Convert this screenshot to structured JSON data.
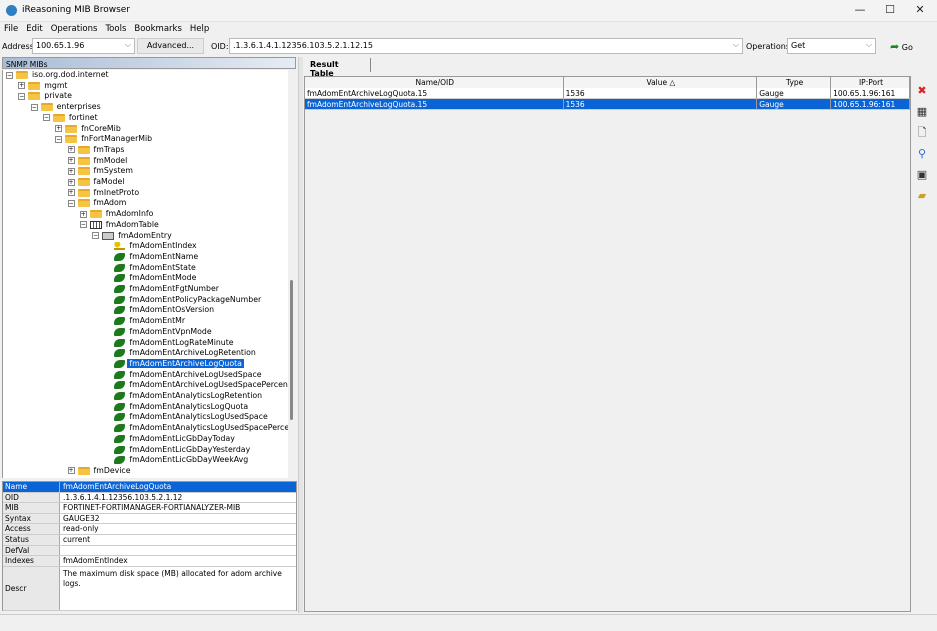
{
  "window": {
    "title": "iReasoning MIB Browser",
    "minimize": "—",
    "maximize": "☐",
    "close": "✕"
  },
  "menu": [
    "File",
    "Edit",
    "Operations",
    "Tools",
    "Bookmarks",
    "Help"
  ],
  "toolbar": {
    "address_label": "Address:",
    "address": "100.65.1.96",
    "advanced": "Advanced...",
    "oid_label": "OID:",
    "oid": ".1.3.6.1.4.1.12356.103.5.2.1.12.15",
    "operations_label": "Operations:",
    "operation": "Get",
    "go": "Go"
  },
  "tree": {
    "header": "SNMP MIBs",
    "nodes": [
      {
        "label": "iso.org.dod.internet",
        "lvl": 0,
        "icon": "folder",
        "exp": "-"
      },
      {
        "label": "mgmt",
        "lvl": 1,
        "icon": "folder",
        "exp": "+"
      },
      {
        "label": "private",
        "lvl": 1,
        "icon": "folder",
        "exp": "-"
      },
      {
        "label": "enterprises",
        "lvl": 2,
        "icon": "folder",
        "exp": "-"
      },
      {
        "label": "fortinet",
        "lvl": 3,
        "icon": "folder",
        "exp": "-"
      },
      {
        "label": "fnCoreMib",
        "lvl": 4,
        "icon": "folder",
        "exp": "+"
      },
      {
        "label": "fnFortManagerMib",
        "lvl": 4,
        "icon": "folder",
        "exp": "-"
      },
      {
        "label": "fmTraps",
        "lvl": 5,
        "icon": "folder",
        "exp": "+"
      },
      {
        "label": "fmModel",
        "lvl": 5,
        "icon": "folder",
        "exp": "+"
      },
      {
        "label": "fmSystem",
        "lvl": 5,
        "icon": "folder",
        "exp": "+"
      },
      {
        "label": "faModel",
        "lvl": 5,
        "icon": "folder",
        "exp": "+"
      },
      {
        "label": "fmInetProto",
        "lvl": 5,
        "icon": "folder",
        "exp": "+"
      },
      {
        "label": "fmAdom",
        "lvl": 5,
        "icon": "folder",
        "exp": "-"
      },
      {
        "label": "fmAdomInfo",
        "lvl": 6,
        "icon": "folder",
        "exp": "+"
      },
      {
        "label": "fmAdomTable",
        "lvl": 6,
        "icon": "table",
        "exp": "-"
      },
      {
        "label": "fmAdomEntry",
        "lvl": 7,
        "icon": "entry",
        "exp": "-"
      },
      {
        "label": "fmAdomEntIndex",
        "lvl": 8,
        "icon": "key",
        "exp": ""
      },
      {
        "label": "fmAdomEntName",
        "lvl": 8,
        "icon": "leaf",
        "exp": ""
      },
      {
        "label": "fmAdomEntState",
        "lvl": 8,
        "icon": "leaf",
        "exp": ""
      },
      {
        "label": "fmAdomEntMode",
        "lvl": 8,
        "icon": "leaf",
        "exp": ""
      },
      {
        "label": "fmAdomEntFgtNumber",
        "lvl": 8,
        "icon": "leaf",
        "exp": ""
      },
      {
        "label": "fmAdomEntPolicyPackageNumber",
        "lvl": 8,
        "icon": "leaf",
        "exp": ""
      },
      {
        "label": "fmAdomEntOsVersion",
        "lvl": 8,
        "icon": "leaf",
        "exp": ""
      },
      {
        "label": "fmAdomEntMr",
        "lvl": 8,
        "icon": "leaf",
        "exp": ""
      },
      {
        "label": "fmAdomEntVpnMode",
        "lvl": 8,
        "icon": "leaf",
        "exp": ""
      },
      {
        "label": "fmAdomEntLogRateMinute",
        "lvl": 8,
        "icon": "leaf",
        "exp": ""
      },
      {
        "label": "fmAdomEntArchiveLogRetention",
        "lvl": 8,
        "icon": "leaf",
        "exp": ""
      },
      {
        "label": "fmAdomEntArchiveLogQuota",
        "lvl": 8,
        "icon": "leaf",
        "exp": "",
        "selected": true
      },
      {
        "label": "fmAdomEntArchiveLogUsedSpace",
        "lvl": 8,
        "icon": "leaf",
        "exp": ""
      },
      {
        "label": "fmAdomEntArchiveLogUsedSpacePercent",
        "lvl": 8,
        "icon": "leaf",
        "exp": ""
      },
      {
        "label": "fmAdomEntAnalyticsLogRetention",
        "lvl": 8,
        "icon": "leaf",
        "exp": ""
      },
      {
        "label": "fmAdomEntAnalyticsLogQuota",
        "lvl": 8,
        "icon": "leaf",
        "exp": ""
      },
      {
        "label": "fmAdomEntAnalyticsLogUsedSpace",
        "lvl": 8,
        "icon": "leaf",
        "exp": ""
      },
      {
        "label": "fmAdomEntAnalyticsLogUsedSpacePercent",
        "lvl": 8,
        "icon": "leaf",
        "exp": ""
      },
      {
        "label": "fmAdomEntLicGbDayToday",
        "lvl": 8,
        "icon": "leaf",
        "exp": ""
      },
      {
        "label": "fmAdomEntLicGbDayYesterday",
        "lvl": 8,
        "icon": "leaf",
        "exp": ""
      },
      {
        "label": "fmAdomEntLicGbDayWeekAvg",
        "lvl": 8,
        "icon": "leaf",
        "exp": ""
      },
      {
        "label": "fmDevice",
        "lvl": 5,
        "icon": "folder",
        "exp": "+"
      }
    ]
  },
  "details": [
    {
      "k": "Name",
      "v": "fmAdomEntArchiveLogQuota"
    },
    {
      "k": "OID",
      "v": ".1.3.6.1.4.1.12356.103.5.2.1.12"
    },
    {
      "k": "MIB",
      "v": "FORTINET-FORTIMANAGER-FORTIANALYZER-MIB"
    },
    {
      "k": "Syntax",
      "v": "GAUGE32"
    },
    {
      "k": "Access",
      "v": "read-only"
    },
    {
      "k": "Status",
      "v": "current"
    },
    {
      "k": "DefVal",
      "v": ""
    },
    {
      "k": "Indexes",
      "v": "fmAdomEntIndex"
    },
    {
      "k": "Descr",
      "v": "The maximum disk space (MB) allocated for adom archive logs."
    }
  ],
  "results": {
    "tab": "Result Table",
    "columns": [
      "Name/OID",
      "Value △",
      "Type",
      "IP:Port"
    ],
    "rows": [
      [
        "fmAdomEntArchiveLogQuota.15",
        "1536",
        "Gauge",
        "100.65.1.96:161"
      ],
      [
        "fmAdomEntArchiveLogQuota.15",
        "1536",
        "Gauge",
        "100.65.1.96:161"
      ]
    ]
  },
  "side_tools": [
    {
      "icon": "stop-icon",
      "g": "✖",
      "c": "#d22"
    },
    {
      "icon": "delete-table-icon",
      "g": "▦",
      "c": "#333"
    },
    {
      "icon": "document-icon",
      "g": "🗋",
      "c": "#333"
    },
    {
      "icon": "search-icon",
      "g": "⚲",
      "c": "#2a6ad8"
    },
    {
      "icon": "export-icon",
      "g": "▣",
      "c": "#333"
    },
    {
      "icon": "open-folder-icon",
      "g": "▰",
      "c": "#c9a227"
    }
  ]
}
